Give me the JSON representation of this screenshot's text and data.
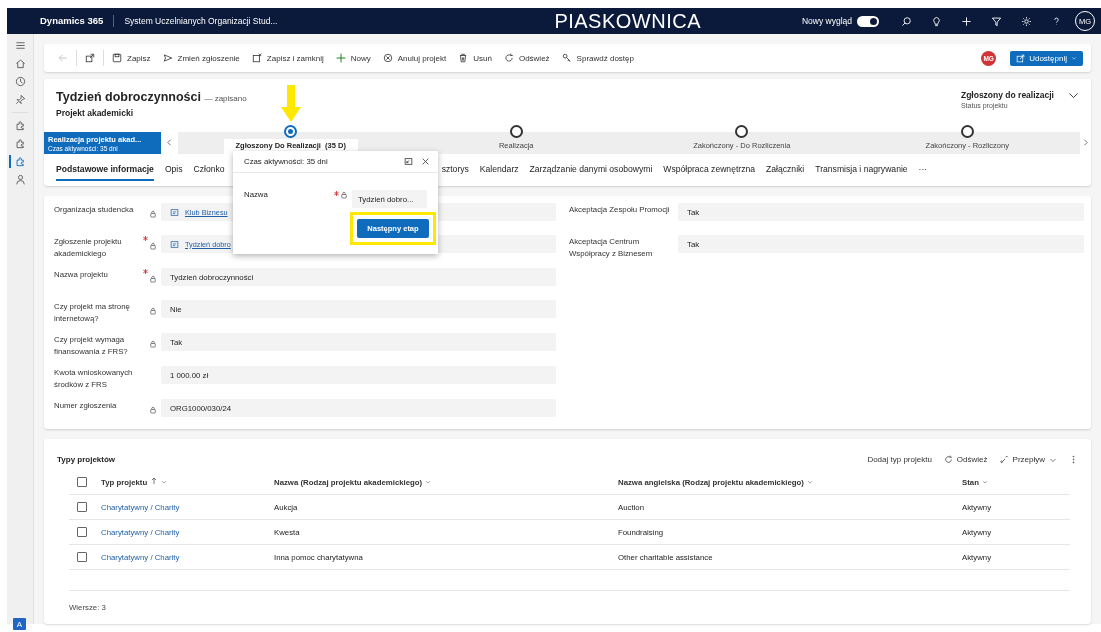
{
  "top_bar": {
    "app_name": "Dynamics 365",
    "area_title": "System Uczelnianych Organizacji Stud...",
    "environment": "PIASKOWNICA",
    "new_look": {
      "label": "Nowy wygląd",
      "on": true
    },
    "avatar": "MG"
  },
  "sidebar": {
    "entities": [
      {
        "selected": false
      },
      {
        "selected": false
      },
      {
        "selected": true
      },
      {
        "selected": false
      }
    ],
    "area_badge": "A"
  },
  "command_bar": {
    "back_disabled": true,
    "items": [
      {
        "label": "Zapisz"
      },
      {
        "label": "Zmień zgłoszenie"
      },
      {
        "label": "Zapisz i zamknij"
      },
      {
        "label": "Nowy"
      },
      {
        "label": "Anuluj projekt"
      },
      {
        "label": "Usuń"
      },
      {
        "label": "Odśwież"
      },
      {
        "label": "Sprawdź dostęp"
      }
    ],
    "avatar": "MG",
    "share_button": "Udostępnij"
  },
  "header": {
    "title": "Tydzień dobroczynności",
    "save_state": "— zapisano",
    "entity": "Projekt akademicki",
    "status_value": "Zgłoszony do realizacji",
    "status_label": "Status projektu"
  },
  "process": {
    "name": "Realizacja projektu akad...",
    "active_time": "Czas aktywności: 35 dni",
    "stages": [
      {
        "label": "Zgłoszony Do Realizacji  (35 D)",
        "selected": true
      },
      {
        "label": "Realizacja",
        "selected": false
      },
      {
        "label": "Zakończony - Do Rozliczenia",
        "selected": false
      },
      {
        "label": "Zakończony - Rozliczony",
        "selected": false
      }
    ]
  },
  "stage_flyout": {
    "active_time": "Czas aktywności: 35 dni",
    "field": {
      "label": "Nazwa",
      "required": true,
      "locked": true,
      "value": "Tydzień dobro..."
    },
    "next_button": "Następny etap"
  },
  "tabs": [
    {
      "label": "Podstawowe informacje",
      "selected": true
    },
    {
      "label": "Opis",
      "selected": false
    },
    {
      "label": "Członko",
      "selected": false
    },
    {
      "label": "sztorys",
      "selected": false
    },
    {
      "label": "Kalendarz",
      "selected": false
    },
    {
      "label": "Zarządzanie danymi osobowymi",
      "selected": false
    },
    {
      "label": "Współpraca zewnętrzna",
      "selected": false
    },
    {
      "label": "Załączniki",
      "selected": false
    },
    {
      "label": "Transmisja i nagrywanie",
      "selected": false
    },
    {
      "label": "···",
      "selected": false
    }
  ],
  "form_left": [
    {
      "label": "Organizacja studencka",
      "required": false,
      "locked": true,
      "kind": "lookup",
      "value": "Klub Biznesu"
    },
    {
      "label": "Zgłoszenie projektu akademickiego",
      "required": true,
      "locked": true,
      "kind": "lookup",
      "value": "Tydzień dobro"
    },
    {
      "label": "Nazwa projektu",
      "required": true,
      "locked": true,
      "kind": "text",
      "value": "Tydzień dobroczynności"
    },
    {
      "label": "Czy projekt ma stronę internetową?",
      "required": false,
      "locked": true,
      "kind": "text",
      "value": "Nie"
    },
    {
      "label": "Czy projekt wymaga finansowania z FRS?",
      "required": false,
      "locked": true,
      "kind": "text",
      "value": "Tak"
    },
    {
      "label": "Kwota wnioskowanych środków z FRS",
      "required": false,
      "locked": false,
      "kind": "text",
      "value": "1 000.00 zł"
    },
    {
      "label": "Numer zgłoszenia",
      "required": false,
      "locked": true,
      "kind": "text",
      "value": "ORG1000/030/24"
    }
  ],
  "form_right": [
    {
      "label": "Akceptacja Zespołu Promocji",
      "value": "Tak"
    },
    {
      "label": "Akceptacja Centrum Współpracy z Biznesem",
      "value": "Tak"
    }
  ],
  "subgrid": {
    "title": "Typy projektów",
    "select_all_checked": false,
    "actions": [
      "Dodaj typ projektu",
      "Odśwież",
      "Przepływ"
    ],
    "columns": [
      {
        "label": "Typ projektu",
        "sorted": true
      },
      {
        "label": "Nazwa (Rodzaj projektu akademickiego)",
        "sorted": false
      },
      {
        "label": "Nazwa angielska (Rodzaj projektu akademickiego)",
        "sorted": false
      },
      {
        "label": "Stan",
        "sorted": false
      }
    ],
    "rows": [
      {
        "checked": false,
        "cells": [
          "Charytatywny / Charity",
          "Aukcja",
          "Auction",
          "Aktywny"
        ]
      },
      {
        "checked": false,
        "cells": [
          "Charytatywny / Charity",
          "Kwesta",
          "Foundraising",
          "Aktywny"
        ]
      },
      {
        "checked": false,
        "cells": [
          "Charytatywny / Charity",
          "Inna pomoc charytatywna",
          "Other charitable assistance",
          "Aktywny"
        ]
      }
    ],
    "footer": "Wiersze: 3"
  }
}
